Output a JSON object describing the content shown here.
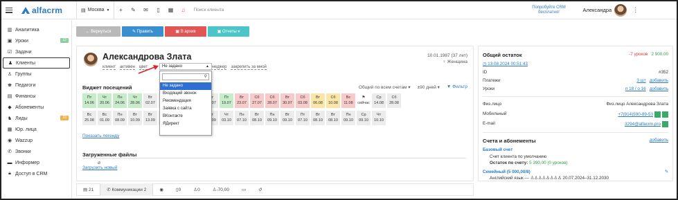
{
  "header": {
    "logo_text": "alfacrm",
    "branch": "Москва",
    "search_placeholder": "Поиск клиента",
    "promo": "Попробуйте CRM бесплатно!",
    "user_name": "Александра"
  },
  "sidebar": {
    "items": [
      {
        "label": "Аналитика",
        "icon": "chart-icon"
      },
      {
        "label": "Уроки",
        "icon": "lessons-icon",
        "badge": "12"
      },
      {
        "label": "Задачи",
        "icon": "tasks-icon"
      },
      {
        "label": "Клиенты",
        "icon": "clients-icon"
      },
      {
        "label": "Группы",
        "icon": "groups-icon"
      },
      {
        "label": "Педагоги",
        "icon": "teachers-icon"
      },
      {
        "label": "Финансы",
        "icon": "finance-icon"
      },
      {
        "label": "Абонементы",
        "icon": "subscriptions-icon"
      },
      {
        "label": "Лиды",
        "icon": "leads-icon",
        "badge": "23"
      },
      {
        "label": "Юр. лица",
        "icon": "legal-icon"
      },
      {
        "label": "Wazzup",
        "icon": "chat-icon"
      },
      {
        "label": "Звонки",
        "icon": "phone-icon"
      },
      {
        "label": "Информер",
        "icon": "informer-icon"
      },
      {
        "label": "Доступ в CRM",
        "icon": "lock-icon"
      }
    ]
  },
  "actions": {
    "back": "← Вернуться",
    "edit": "✎ Править",
    "archive": "▣ В архив",
    "reports": "▣ Отчеты ▾"
  },
  "client": {
    "name": "Александрова Злата",
    "chips": [
      "клиент",
      "активен",
      "цвет"
    ],
    "dob": "10.01.1987 (37 лет)",
    "gender": "♀ Женщина",
    "manager": "менеджер",
    "assign": "закрепить за мной"
  },
  "dropdown": {
    "value": "Не задано",
    "options": [
      "Не задано",
      "Входящий звонок",
      "Рекомендация",
      "Заявка с сайта",
      "ВКонтакте",
      "ЯДирект"
    ]
  },
  "widget": {
    "title": "Виджет посещений",
    "account": "Общий по всем счетам ▾",
    "period": "±90 дней ▾",
    "filter": "▼ Фильтр",
    "legend": "Показать легенду",
    "row1": [
      {
        "d": "Пт",
        "n": "14.06",
        "c": "green"
      },
      {
        "d": "Чт",
        "n": "20.06",
        "c": "green"
      },
      {
        "d": "Пн",
        "n": "24.06",
        "c": "green"
      },
      {
        "d": "Чт",
        "n": "28.06",
        "c": "green"
      },
      {
        "d": "Вт",
        "n": "02.07",
        "c": "gray"
      },
      {
        "d": "Чт",
        "n": "04.07",
        "c": "gray"
      },
      {
        "d": "Вт",
        "n": "09.07",
        "c": "gray"
      },
      {
        "d": "Чт",
        "n": "11.07",
        "c": "gray"
      },
      {
        "d": "Вт",
        "n": "16.07",
        "c": "gray"
      },
      {
        "d": "Пт",
        "n": "19.07",
        "c": "green"
      },
      {
        "d": "Вт",
        "n": "23.07",
        "c": "red"
      },
      {
        "d": "Сб",
        "n": "27.07",
        "c": "red"
      },
      {
        "d": "Сб",
        "n": "28.07",
        "c": "red"
      },
      {
        "d": "Вт",
        "n": "30.07",
        "c": "red"
      },
      {
        "d": "Сб",
        "n": "03.08",
        "c": "red"
      },
      {
        "d": "Вт",
        "n": "06.08",
        "c": "yellow"
      },
      {
        "d": "Сб",
        "n": "10.08",
        "c": "yellow"
      },
      {
        "d": "Вс",
        "n": "11.08",
        "c": "red"
      },
      {
        "d": "⚑",
        "n": "сейчас",
        "c": "white"
      },
      {
        "d": "Ср",
        "n": "14.08",
        "c": "gray"
      },
      {
        "d": "Сб",
        "n": "28.08",
        "c": "gray"
      }
    ],
    "row2": [
      {
        "d": "Вс",
        "n": "25.08",
        "c": "gray"
      },
      {
        "d": "Вс",
        "n": "01.09",
        "c": "gray"
      },
      {
        "d": "Пн",
        "n": "08.09",
        "c": "gray"
      },
      {
        "d": "Вт",
        "n": "10.09",
        "c": "gray"
      },
      {
        "d": "Вт",
        "n": "13.09",
        "c": "gray"
      },
      {
        "d": "Вт",
        "n": "17.09",
        "c": "gray"
      },
      {
        "d": "Вт",
        "n": "24.09",
        "c": "gray"
      },
      {
        "d": "Чт",
        "n": "26.09",
        "c": "gray"
      },
      {
        "d": "Вт",
        "n": "29.09",
        "c": "gray"
      },
      {
        "d": "Чт",
        "n": "03.10",
        "c": "gray"
      },
      {
        "d": "Пн",
        "n": "07.10",
        "c": "gray"
      },
      {
        "d": "Вт",
        "n": "08.10",
        "c": "gray"
      },
      {
        "d": "Пн",
        "n": "09.10",
        "c": "gray"
      },
      {
        "d": "Вт",
        "n": "09.10",
        "c": "gray"
      },
      {
        "d": "Пт",
        "n": "07.10",
        "c": "gray"
      },
      {
        "d": "Вт",
        "n": "08.10",
        "c": "gray"
      },
      {
        "d": "Вт",
        "n": "08.10",
        "c": "gray"
      },
      {
        "d": "Пн",
        "n": "09.10",
        "c": "gray"
      },
      {
        "d": "Ср",
        "n": "09.10",
        "c": "gray"
      },
      {
        "d": "Чт",
        "n": "10.10",
        "c": "gray"
      }
    ]
  },
  "files": {
    "title": "Загруженные файлы",
    "upload": "Загрузить новый"
  },
  "tabs": [
    {
      "label": "21",
      "icon": "comments-icon"
    },
    {
      "label": "Коммуникации 2",
      "icon": "phone-icon"
    },
    {
      "label": "",
      "icon": "whatsapp-icon"
    },
    {
      "label": "0",
      "icon": "docs-icon"
    },
    {
      "label": "0",
      "icon": "lessons-icon"
    },
    {
      "label": "-70,00",
      "icon": "money-icon"
    },
    {
      "label": "",
      "icon": "card-icon"
    },
    {
      "label": "",
      "icon": "history-icon"
    }
  ],
  "right": {
    "total_title": "Общий остаток",
    "total_lessons": "-7 уроков",
    "total_money": "2 900,00",
    "date_link": "◷ 13.08.2024 00:51:43",
    "id_label": "ID",
    "id_value": "#352",
    "payments_label": "Платежи",
    "payments_value": "3 шт",
    "payments_add": "добавить",
    "lessons_label": "Уроки",
    "lessons_value": "п 18 / о 16",
    "lessons_add": "добавить",
    "person_label": "Физ.лицо",
    "person_value": "Физ.лицо Александрова Злата",
    "mobile_label": "Мобильный",
    "mobile_value": "+7(914)590-89-53",
    "email_label": "E-mail",
    "email_value": "3294@alfacrm.pro",
    "accounts_title": "Счета и абонементы",
    "accounts_add": "добавить",
    "base_account": "Базовый счет",
    "base_desc": "Счет клиента по умолчанию",
    "base_balance_label": "Остаток по счету:",
    "base_balance": "5 390,00 (0 уроков)",
    "family_account": "Семейный (5 000,00/8)",
    "family_course": "Английский язык — ♙♙♙♙♙♙♙♙ 20.07.2024–31.12.2030",
    "family_balance_label": "Остаток по счету:",
    "family_balance": "-2 400,00 (-7 уроков)"
  }
}
